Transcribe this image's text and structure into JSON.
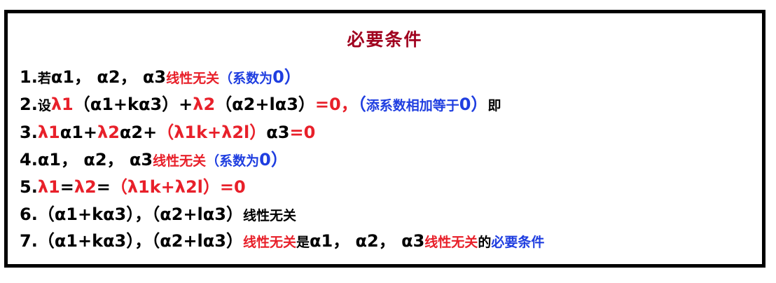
{
  "title": "必要条件",
  "colors": {
    "black": "#000000",
    "red": "#e8202a",
    "blue": "#1f3ee0",
    "title": "#a0001e"
  },
  "lines": [
    [
      {
        "t": "1.",
        "c": "k"
      },
      {
        "t": "若",
        "c": "k",
        "cn": true
      },
      {
        "t": "α1， α2， α3",
        "c": "k"
      },
      {
        "t": "线性无关",
        "c": "r",
        "cn": true
      },
      {
        "t": "（系数为",
        "c": "b",
        "cn": true
      },
      {
        "t": "0）",
        "c": "b"
      }
    ],
    [
      {
        "t": "2.",
        "c": "k"
      },
      {
        "t": "设",
        "c": "k",
        "cn": true
      },
      {
        "t": "λ1",
        "c": "r"
      },
      {
        "t": "（α1+kα3）+",
        "c": "k"
      },
      {
        "t": "λ2",
        "c": "r"
      },
      {
        "t": "（α2+lα3）",
        "c": "k"
      },
      {
        "t": "=0，",
        "c": "r"
      },
      {
        "t": "（",
        "c": "b"
      },
      {
        "t": "添系数相加等于",
        "c": "b",
        "cn": true
      },
      {
        "t": "0）",
        "c": "b"
      },
      {
        "t": "即",
        "c": "k",
        "cn": true
      }
    ],
    [
      {
        "t": "3.",
        "c": "k"
      },
      {
        "t": "λ1",
        "c": "r"
      },
      {
        "t": "α1+",
        "c": "k"
      },
      {
        "t": "λ2",
        "c": "r"
      },
      {
        "t": "α2+",
        "c": "k"
      },
      {
        "t": "（λ1k+λ2l）",
        "c": "r"
      },
      {
        "t": "α3",
        "c": "k"
      },
      {
        "t": "=0",
        "c": "r"
      }
    ],
    [
      {
        "t": "4.α1， α2， α3",
        "c": "k"
      },
      {
        "t": "线性无关",
        "c": "r",
        "cn": true
      },
      {
        "t": "（系数为",
        "c": "b",
        "cn": true
      },
      {
        "t": "0）",
        "c": "b"
      }
    ],
    [
      {
        "t": "5.",
        "c": "k"
      },
      {
        "t": "λ1",
        "c": "r"
      },
      {
        "t": "=",
        "c": "k"
      },
      {
        "t": "λ2",
        "c": "r"
      },
      {
        "t": "=",
        "c": "k"
      },
      {
        "t": "（λ1k+λ2l）=0",
        "c": "r"
      }
    ],
    [
      {
        "t": "6.（α1+kα3），（α2+lα3）",
        "c": "k"
      },
      {
        "t": "线性无关",
        "c": "k",
        "cn": true
      }
    ],
    [
      {
        "t": "7.（α1+kα3），（α2+lα3）",
        "c": "k"
      },
      {
        "t": "线性无关",
        "c": "r",
        "cn": true
      },
      {
        "t": "是",
        "c": "k",
        "cn": true
      },
      {
        "t": "α1， α2， α3",
        "c": "k"
      },
      {
        "t": "线性无关",
        "c": "r",
        "cn": true
      },
      {
        "t": "的",
        "c": "k",
        "cn": true
      },
      {
        "t": "必要条件",
        "c": "b",
        "cn": true
      }
    ]
  ]
}
